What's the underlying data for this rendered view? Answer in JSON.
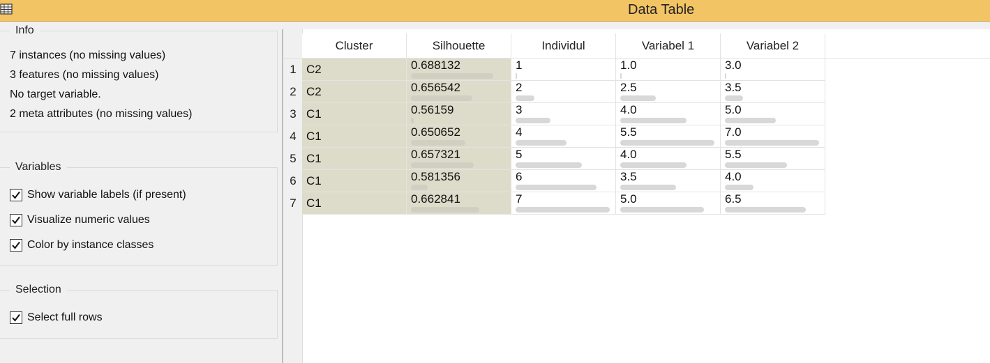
{
  "window": {
    "title": "Data Table"
  },
  "info": {
    "title": "Info",
    "lines": [
      "7 instances (no missing values)",
      "3 features (no missing values)",
      "No target variable.",
      "2 meta attributes (no missing values)"
    ]
  },
  "variables": {
    "title": "Variables",
    "options": [
      {
        "label": "Show variable labels (if present)",
        "checked": true
      },
      {
        "label": "Visualize numeric values",
        "checked": true
      },
      {
        "label": "Color by instance classes",
        "checked": true
      }
    ]
  },
  "selection": {
    "title": "Selection",
    "options": [
      {
        "label": "Select full rows",
        "checked": true
      }
    ]
  },
  "table": {
    "columns": [
      "Cluster",
      "Silhouette",
      "Individul",
      "Variabel 1",
      "Variabel 2"
    ],
    "rows": [
      {
        "n": "1",
        "cells": [
          "C2",
          "0.688132",
          "1",
          "1.0",
          "3.0"
        ]
      },
      {
        "n": "2",
        "cells": [
          "C2",
          "0.656542",
          "2",
          "2.5",
          "3.5"
        ]
      },
      {
        "n": "3",
        "cells": [
          "C1",
          "0.56159",
          "3",
          "4.0",
          "5.0"
        ]
      },
      {
        "n": "4",
        "cells": [
          "C1",
          "0.650652",
          "4",
          "5.5",
          "7.0"
        ]
      },
      {
        "n": "5",
        "cells": [
          "C1",
          "0.657321",
          "5",
          "4.0",
          "5.5"
        ]
      },
      {
        "n": "6",
        "cells": [
          "C1",
          "0.581356",
          "6",
          "3.5",
          "4.0"
        ]
      },
      {
        "n": "7",
        "cells": [
          "C1",
          "0.662841",
          "7",
          "5.0",
          "6.5"
        ]
      }
    ],
    "bar_fractions": {
      "Silhouette": [
        0.98,
        0.73,
        0.03,
        0.65,
        0.75,
        0.2,
        0.82
      ],
      "Individul": [
        0.0,
        0.2,
        0.37,
        0.54,
        0.7,
        0.86,
        1.0
      ],
      "Variabel 1": [
        0.0,
        0.38,
        0.7,
        1.0,
        0.7,
        0.59,
        0.89
      ],
      "Variabel 2": [
        0.0,
        0.19,
        0.54,
        1.0,
        0.66,
        0.3,
        0.86
      ]
    }
  },
  "colors": {
    "titlebar": "#f2c464",
    "meta_cell": "#dddcca",
    "bar": "#d8d8d8"
  }
}
